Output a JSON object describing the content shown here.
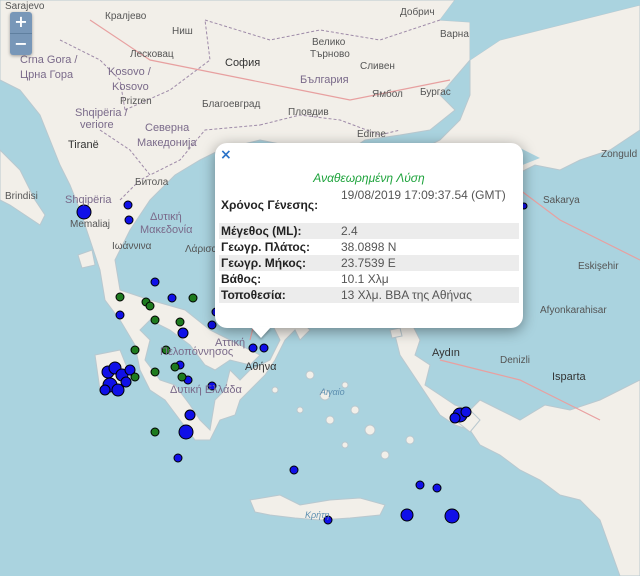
{
  "zoom": {
    "in_label": "+",
    "out_label": "−"
  },
  "map_labels": {
    "sarajevo": "Sarajevo",
    "kraljevo": "Кралјево",
    "nis": "Ниш",
    "crna_gora": "Crna Gora /",
    "crna_gora_cyr": "Црна Гора",
    "leskovac": "Лесковац",
    "kosovo": "Kosovo /",
    "kosovo_cyr": "Kosovo",
    "prizren": "Prizren",
    "sofia": "София",
    "bulgaria": "България",
    "veliko": "Велико",
    "tarnovo": "Търново",
    "sliven": "Сливен",
    "yambol": "Ямбол",
    "burgas": "Бургас",
    "plovdiv": "Пловдив",
    "blagoevgrad": "Благоевград",
    "dobrich": "Добрич",
    "varna": "Варна",
    "edirne": "Edirne",
    "zonguldak": "Zonguld",
    "shqiperia": "Shqipëria",
    "shqiperia_sub": "Shqipëria /",
    "veriore": "veriore",
    "tirane": "Tiranë",
    "severna": "Северна",
    "makedonija": "Македонија",
    "bitola": "Битола",
    "brindisi": "Brindisi",
    "shqiperia2": "Shqipëria",
    "dytiki": "Δυτική",
    "makedonia": "Μακεδονία",
    "memaliaj": "Memaliaj",
    "ioannina": "Ιωάννινα",
    "larisa": "Λάρισα",
    "sakarya": "Sakarya",
    "eskisehir": "Eskişehir",
    "afyonkarahisar": "Afyonkarahisar",
    "aydin": "Aydın",
    "isparta": "Isparta",
    "denizli": "Denizli",
    "athina": "Αθήνα",
    "aigaio": "Αιγαίο",
    "kriti": "Κρήτη",
    "peloponnisos": "Πελοπόννησος",
    "attiki": "Αττική",
    "dytiki_ellada": "Δυτική Ελλάδα"
  },
  "popup": {
    "close_label": "×",
    "title": "Αναθεωρημένη Λύση",
    "rows": [
      {
        "label": "Χρόνος Γένεσης:",
        "value": "19/08/2019 17:09:37.54 (GMT)"
      },
      {
        "label": "Μέγεθος (ML):",
        "value": "2.4"
      },
      {
        "label": "Γεωγρ. Πλάτος:",
        "value": "38.0898 N"
      },
      {
        "label": "Γεωγρ. Μήκος:",
        "value": "23.7539 E"
      },
      {
        "label": "Βάθος:",
        "value": "10.1 Χλμ"
      },
      {
        "label": "Τοποθεσία:",
        "value": "13 Χλμ. ΒΒΑ της Αθήνας"
      }
    ]
  },
  "colors": {
    "sea": "#aad3df",
    "land": "#f2efe9",
    "marker_blue": "#1010e8",
    "marker_green": "#1e7a1e",
    "popup_title": "#1ea33c"
  }
}
